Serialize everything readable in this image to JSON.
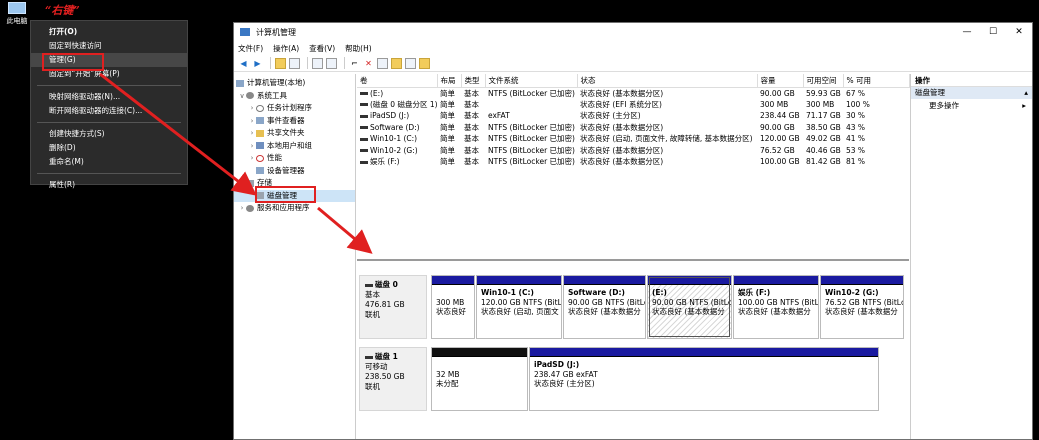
{
  "desktop": {
    "icon_label": "此电脑",
    "annotation": "“右键”"
  },
  "context_menu": {
    "items": [
      "打开(O)",
      "固定到快速访问",
      "管理(G)",
      "固定到“开始”屏幕(P)",
      "映射网络驱动器(N)...",
      "断开网络驱动器的连接(C)...",
      "创建快捷方式(S)",
      "删除(D)",
      "重命名(M)",
      "属性(R)"
    ]
  },
  "window": {
    "title": "计算机管理",
    "controls": [
      "—",
      "☐",
      "✕"
    ],
    "menu": [
      "文件(F)",
      "操作(A)",
      "查看(V)",
      "帮助(H)"
    ]
  },
  "tree": {
    "root": "计算机管理(本地)",
    "system_tools": "系统工具",
    "task_scheduler": "任务计划程序",
    "event_viewer": "事件查看器",
    "shared_folders": "共享文件夹",
    "local_users": "本地用户和组",
    "performance": "性能",
    "device_manager": "设备管理器",
    "storage": "存储",
    "disk_management": "磁盘管理",
    "services": "服务和应用程序"
  },
  "volumes": {
    "columns": [
      "卷",
      "布局",
      "类型",
      "文件系统",
      "状态",
      "容量",
      "可用空间",
      "% 可用"
    ],
    "rows": [
      [
        "(E:)",
        "简单",
        "基本",
        "NTFS (BitLocker 已加密)",
        "状态良好 (基本数据分区)",
        "90.00 GB",
        "59.93 GB",
        "67 %"
      ],
      [
        "(磁盘 0 磁盘分区 1)",
        "简单",
        "基本",
        "",
        "状态良好 (EFI 系统分区)",
        "300 MB",
        "300 MB",
        "100 %"
      ],
      [
        "iPadSD (J:)",
        "简单",
        "基本",
        "exFAT",
        "状态良好 (主分区)",
        "238.44 GB",
        "71.17 GB",
        "30 %"
      ],
      [
        "Software (D:)",
        "简单",
        "基本",
        "NTFS (BitLocker 已加密)",
        "状态良好 (基本数据分区)",
        "90.00 GB",
        "38.50 GB",
        "43 %"
      ],
      [
        "Win10-1 (C:)",
        "简单",
        "基本",
        "NTFS (BitLocker 已加密)",
        "状态良好 (启动, 页面文件, 故障转储, 基本数据分区)",
        "120.00 GB",
        "49.02 GB",
        "41 %"
      ],
      [
        "Win10-2 (G:)",
        "简单",
        "基本",
        "NTFS (BitLocker 已加密)",
        "状态良好 (基本数据分区)",
        "76.52 GB",
        "40.46 GB",
        "53 %"
      ],
      [
        "娱乐 (F:)",
        "简单",
        "基本",
        "NTFS (BitLocker 已加密)",
        "状态良好 (基本数据分区)",
        "100.00 GB",
        "81.42 GB",
        "81 %"
      ]
    ]
  },
  "disks": [
    {
      "name": "磁盘 0",
      "kind": "基本",
      "size": "476.81 GB",
      "status": "联机",
      "partitions": [
        {
          "name": "",
          "line1": "300 MB",
          "line2": "状态良好"
        },
        {
          "name": "Win10-1  (C:)",
          "line1": "120.00 GB NTFS (BitLc",
          "line2": "状态良好 (启动, 页面文"
        },
        {
          "name": "Software  (D:)",
          "line1": "90.00 GB NTFS (BitLoc",
          "line2": "状态良好 (基本数据分"
        },
        {
          "name": "(E:)",
          "line1": "90.00 GB NTFS (BitLoc",
          "line2": "状态良好 (基本数据分"
        },
        {
          "name": "娱乐  (F:)",
          "line1": "100.00 GB NTFS (BitLc",
          "line2": "状态良好 (基本数据分"
        },
        {
          "name": "Win10-2  (G:)",
          "line1": "76.52 GB NTFS (BitLc",
          "line2": "状态良好 (基本数据分"
        }
      ]
    },
    {
      "name": "磁盘 1",
      "kind": "可移动",
      "size": "238.50 GB",
      "status": "联机",
      "partitions": [
        {
          "name": "",
          "line1": "32 MB",
          "line2": "未分配"
        },
        {
          "name": "iPadSD  (J:)",
          "line1": "238.47 GB exFAT",
          "line2": "状态良好 (主分区)"
        }
      ]
    }
  ],
  "actions": {
    "title": "操作",
    "section": "磁盘管理",
    "more": "更多操作"
  },
  "colors": {
    "annotation_red": "#e02020",
    "partition_blue": "#1a1aa0",
    "unallocated_black": "#101010",
    "menu_bg": "#2b2b2b"
  }
}
